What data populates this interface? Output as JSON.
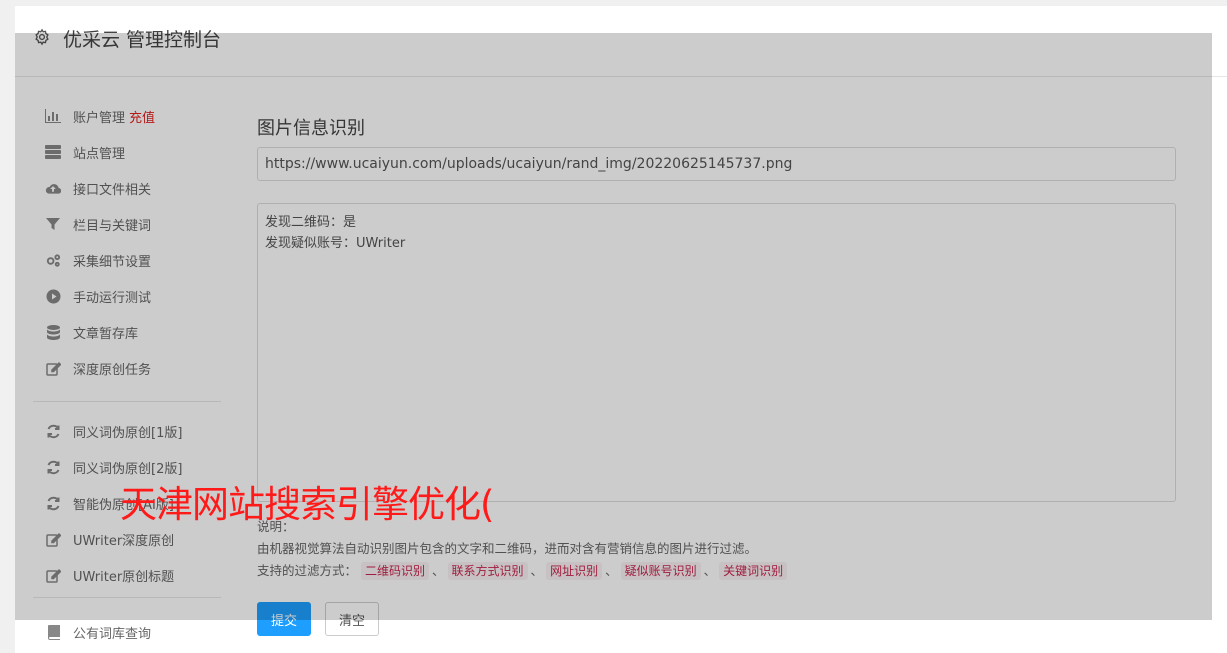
{
  "header": {
    "title": "优采云 管理控制台",
    "icon": "gear-icon"
  },
  "sidebar": {
    "group1": [
      {
        "label": "账户管理",
        "extra": "充值",
        "icon": "bar-chart-icon"
      },
      {
        "label": "站点管理",
        "icon": "server-icon"
      },
      {
        "label": "接口文件相关",
        "icon": "cloud-upload-icon"
      },
      {
        "label": "栏目与关键词",
        "icon": "filter-icon"
      },
      {
        "label": "采集细节设置",
        "icon": "gears-icon"
      },
      {
        "label": "手动运行测试",
        "icon": "play-circle-icon"
      },
      {
        "label": "文章暂存库",
        "icon": "database-icon"
      },
      {
        "label": "深度原创任务",
        "icon": "edit-icon"
      }
    ],
    "group2": [
      {
        "label": "同义词伪原创[1版]",
        "icon": "refresh-icon"
      },
      {
        "label": "同义词伪原创[2版]",
        "icon": "refresh-icon"
      },
      {
        "label": "智能伪原创[AI版]",
        "icon": "refresh-icon"
      },
      {
        "label": "UWriter深度原创",
        "icon": "edit-icon"
      },
      {
        "label": "UWriter原创标题",
        "icon": "edit-icon"
      }
    ],
    "group3": [
      {
        "label": "公有词库查询",
        "icon": "book-icon"
      }
    ]
  },
  "main": {
    "page_title": "图片信息识别",
    "url_value": "https://www.ucaiyun.com/uploads/ucaiyun/rand_img/20220625145737.png",
    "result_lines": [
      "发现二维码：是",
      "发现疑似账号：UWriter"
    ],
    "notes_heading": "说明：",
    "notes_description": "由机器视觉算法自动识别图片包含的文字和二维码，进而对含有营销信息的图片进行过滤。",
    "filter_label": "支持的过滤方式：",
    "filter_tags": [
      "二维码识别",
      "联系方式识别",
      "网址识别",
      "疑似账号识别",
      "关键词识别"
    ],
    "separator": "、",
    "submit_label": "提交",
    "clear_label": "清空"
  },
  "watermark": "天津网站搜索引擎优化(",
  "colors": {
    "accent": "#1e9fff",
    "danger": "#e02020",
    "tag_text": "#c7254e",
    "tag_bg": "#f9f2f4",
    "watermark": "#ff1a1a",
    "overlay": "rgba(0,0,0,0.2)"
  }
}
